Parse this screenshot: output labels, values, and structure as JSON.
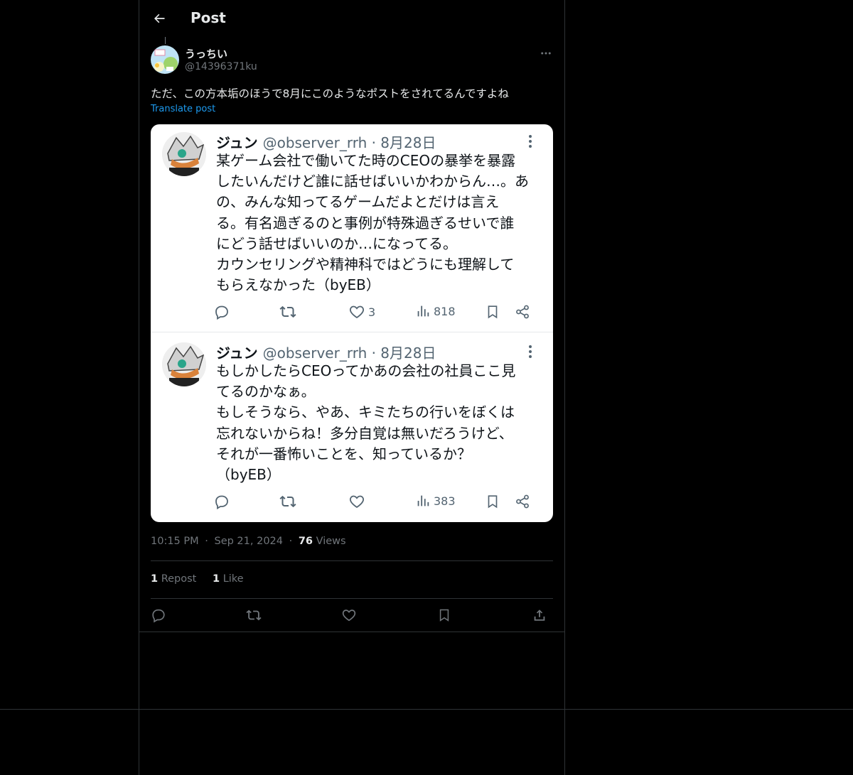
{
  "header": {
    "title": "Post"
  },
  "author": {
    "display_name": "うっちい",
    "handle": "@14396371ku"
  },
  "post": {
    "text": "ただ、この方本垢のほうで8月にこのようなポストをされてるんですよね",
    "translate_label": "Translate post"
  },
  "embedded_tweets": [
    {
      "name": "ジュン",
      "meta": "@observer_rrh · 8月28日",
      "body": "某ゲーム会社で働いてた時のCEOの暴挙を暴露\nしたいんだけど誰に話せばいいかわからん…。あ\nの、みんな知ってるゲームだよとだけは言え\nる。有名過ぎるのと事例が特殊過ぎるせいで誰\nにどう話せばいいのか…になってる。\nカウンセリングや精神科ではどうにも理解して\nもらえなかった（byEB）",
      "likes": "3",
      "views": "818"
    },
    {
      "name": "ジュン",
      "meta": "@observer_rrh · 8月28日",
      "body": "もしかしたらCEOってかあの会社の社員ここ見\nてるのかなぁ。\nもしそうなら、やあ、キミたちの行いをぼくは\n忘れないからね！多分自覚は無いだろうけど、\nそれが一番怖いことを、知っているか？\n（byEB）",
      "likes": "",
      "views": "383"
    }
  ],
  "meta": {
    "time": "10:15 PM",
    "sep": "·",
    "date": "Sep 21, 2024",
    "views_count": "76",
    "views_label": "Views"
  },
  "stats": {
    "reposts_count": "1",
    "reposts_label": "Repost",
    "likes_count": "1",
    "likes_label": "Like"
  },
  "icons": {
    "back": "arrow-left-icon",
    "more": "more-horizontal-icon",
    "reply": "reply-icon",
    "repost": "repost-icon",
    "like": "heart-icon",
    "bookmark": "bookmark-icon",
    "share": "share-icon"
  },
  "colors": {
    "background": "#000000",
    "text": "#e7e9ea",
    "muted": "#71767b",
    "link": "#1d9bf0",
    "border": "#2f3336"
  }
}
